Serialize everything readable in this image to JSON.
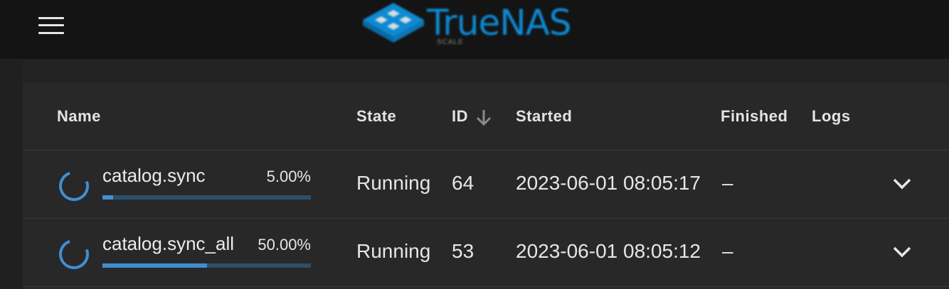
{
  "header": {
    "menu_icon": "hamburger-menu-icon",
    "logo_text": "TrueNAS",
    "logo_sub": "SCALE",
    "logo_color": "#0d8ad2"
  },
  "table": {
    "columns": {
      "name": "Name",
      "state": "State",
      "id": "ID",
      "started": "Started",
      "finished": "Finished",
      "logs": "Logs"
    },
    "sort_icon": "arrow-down-icon",
    "rows": [
      {
        "name": "catalog.sync",
        "percent_label": "5.00%",
        "progress": 0.05,
        "state": "Running",
        "id": "64",
        "started": "2023-06-01 08:05:17",
        "finished": "–"
      },
      {
        "name": "catalog.sync_all",
        "percent_label": "50.00%",
        "progress": 0.5,
        "state": "Running",
        "id": "53",
        "started": "2023-06-01 08:05:12",
        "finished": "–"
      }
    ]
  },
  "colors": {
    "background": "#232323",
    "topbar": "#141414",
    "progress_fill": "#3f8fd3",
    "progress_track": "#2c4f6b",
    "spinner": "#3f8fd3"
  }
}
